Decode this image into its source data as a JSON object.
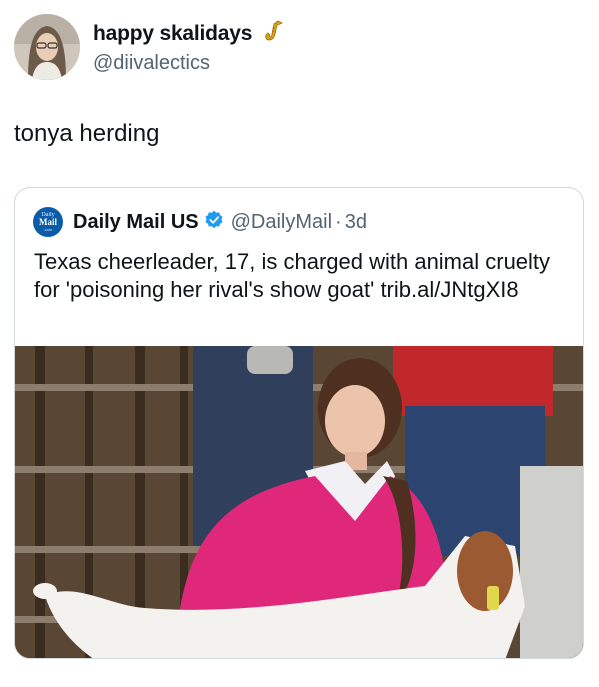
{
  "author": {
    "display_name": "happy skalidays",
    "handle": "@diivalectics",
    "badge_icon": "saxophone-icon"
  },
  "tweet": {
    "text": "tonya herding"
  },
  "quoted_tweet": {
    "display_name": "Daily Mail US",
    "handle": "@DailyMail",
    "separator": "·",
    "time": "3d",
    "text": "Texas cheerleader, 17, is charged with animal cruelty for 'poisoning her rival's show goat' trib.al/JNtgXI8",
    "logo": {
      "line1": "Daily",
      "line2": "Mail",
      "line3": ".com"
    }
  },
  "colors": {
    "text": "#0f1419",
    "secondary": "#536471",
    "border": "#cfd9de",
    "verified": "#1d9bf0",
    "dailymail_blue": "#0b5ca8"
  }
}
